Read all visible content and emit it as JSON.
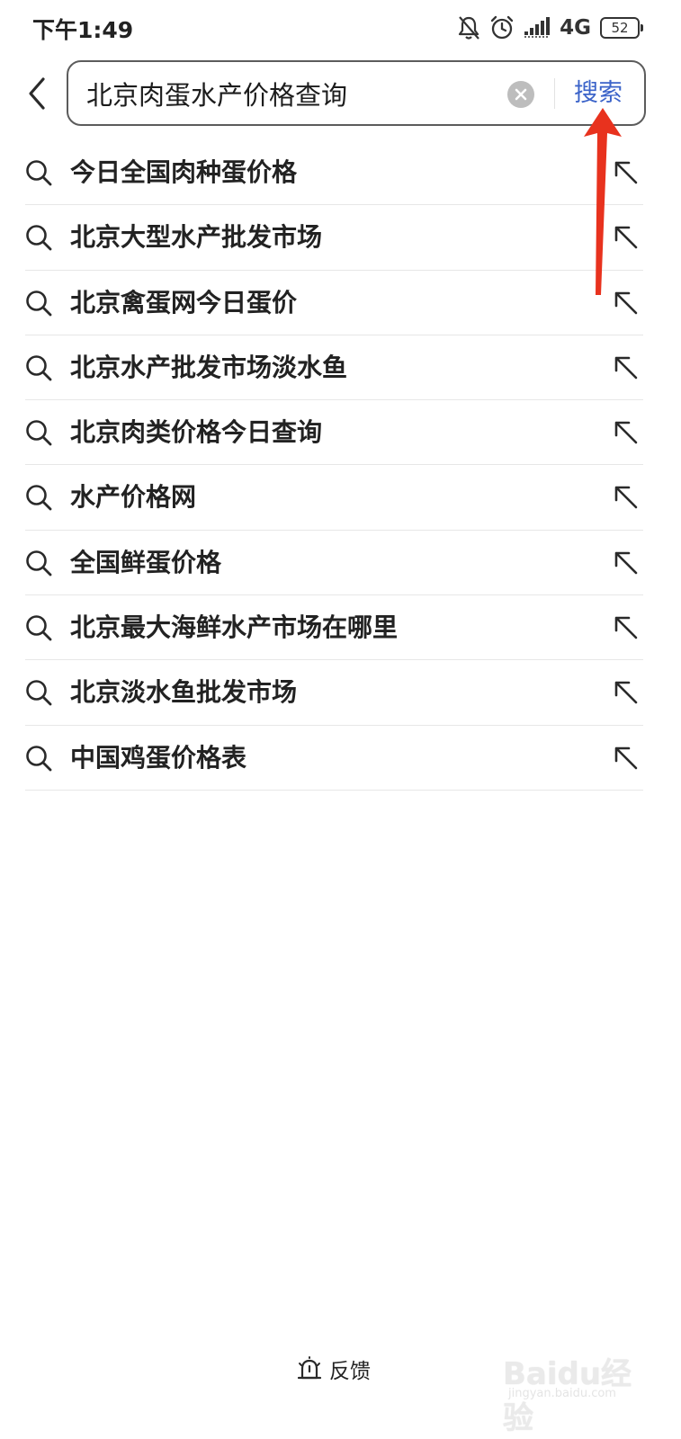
{
  "status_bar": {
    "time": "下午1:49",
    "network": "4G",
    "battery": "52"
  },
  "search": {
    "query": "北京肉蛋水产价格查询",
    "button_label": "搜索"
  },
  "suggestions": [
    "今日全国肉种蛋价格",
    "北京大型水产批发市场",
    "北京禽蛋网今日蛋价",
    "北京水产批发市场淡水鱼",
    "北京肉类价格今日查询",
    "水产价格网",
    "全国鲜蛋价格",
    "北京最大海鲜水产市场在哪里",
    "北京淡水鱼批发市场",
    "中国鸡蛋价格表"
  ],
  "footer": {
    "feedback_label": "反馈"
  },
  "watermark": {
    "brand": "Baidu经验",
    "url": "jingyan.baidu.com"
  },
  "colors": {
    "accent": "#3b63c9",
    "annotation": "#e8321e"
  },
  "icons": [
    "back-icon",
    "clear-icon",
    "search-icon",
    "fill-arrow-icon",
    "feedback-icon",
    "mute-icon",
    "alarm-icon",
    "signal-icon",
    "battery-icon"
  ]
}
